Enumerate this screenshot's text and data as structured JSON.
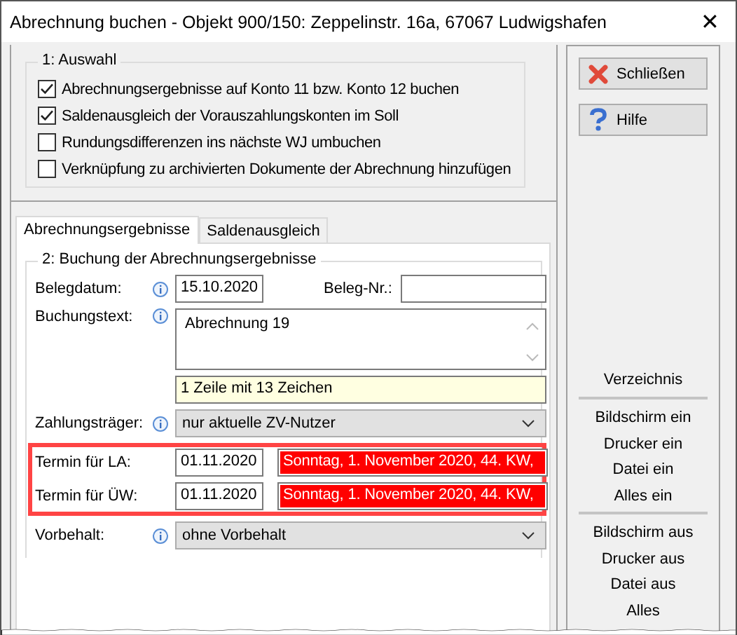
{
  "window": {
    "title": "Abrechnung buchen - Objekt 900/150: Zeppelinstr. 16a, 67067 Ludwigshafen",
    "close": "✕"
  },
  "selection": {
    "title": "1: Auswahl",
    "options": [
      {
        "label": "Abrechnungsergebnisse auf Konto 11 bzw. Konto 12 buchen",
        "checked": true
      },
      {
        "label": "Saldenausgleich der Vorauszahlungskonten im Soll",
        "checked": true
      },
      {
        "label": "Rundungsdifferenzen ins nächste WJ umbuchen",
        "checked": false
      },
      {
        "label": "Verknüpfung zu archivierten Dokumente der Abrechnung hinzufügen",
        "checked": false
      }
    ]
  },
  "tabs": [
    {
      "label": "Abrechnungsergebnisse",
      "selected": true
    },
    {
      "label": "Saldenausgleich",
      "selected": false
    }
  ],
  "booking": {
    "title": "2: Buchung der Abrechnungsergebnisse",
    "belegdatum": {
      "label": "Belegdatum:",
      "value": "15.10.2020"
    },
    "beleg_nr": {
      "label": "Beleg-Nr.:"
    },
    "buchungstext": {
      "label": "Buchungstext:",
      "value": "Abrechnung 19"
    },
    "info_line": "1 Zeile mit 13 Zeichen",
    "zahlungstraeger": {
      "label": "Zahlungsträger:",
      "value": "nur aktuelle ZV-Nutzer"
    },
    "termine": [
      {
        "label": "Termin für LA:",
        "date": "01.11.2020",
        "weekday_text": "Sonntag,  1. November 2020,  44. KW,"
      },
      {
        "label": "Termin für ÜW:",
        "date": "01.11.2020",
        "weekday_text": "Sonntag,  1. November 2020,  44. KW,"
      }
    ],
    "vorbehalt": {
      "label": "Vorbehalt:",
      "value": "ohne Vorbehalt"
    }
  },
  "buttons": [
    {
      "label": "Schließen",
      "kind": "close"
    },
    {
      "label": "Hilfe",
      "kind": "help"
    }
  ],
  "report_menu": {
    "title": "Verzeichnis",
    "groups": [
      [
        "Bildschirm ein",
        "Drucker ein",
        "Datei ein",
        "Alles ein"
      ],
      [
        "Bildschirm aus",
        "Drucker aus",
        "Datei aus",
        "Alles"
      ]
    ]
  }
}
